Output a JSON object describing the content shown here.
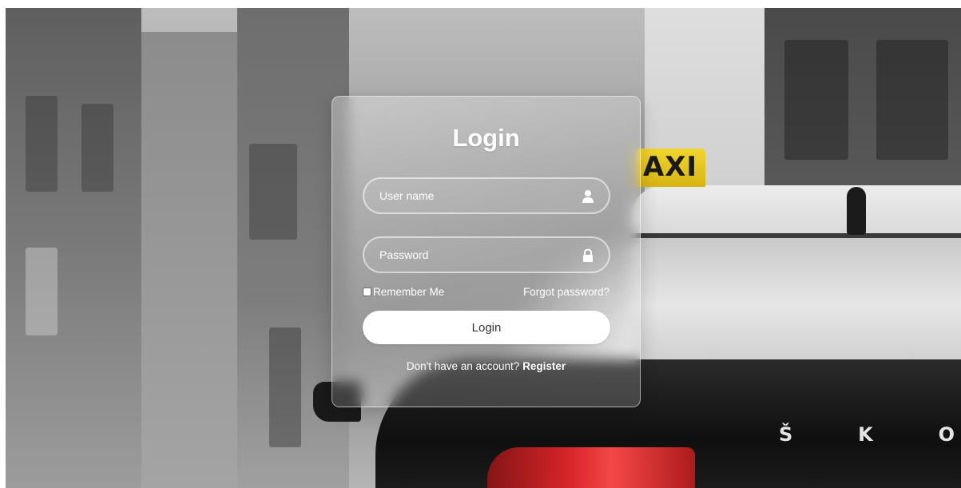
{
  "background": {
    "taxi_sign_text": "AXI",
    "car_badge_letters": [
      "Š",
      "K",
      "O"
    ]
  },
  "login": {
    "title": "Login",
    "username_placeholder": "User name",
    "username_icon": "user-icon",
    "password_placeholder": "Password",
    "password_icon": "lock-icon",
    "remember_label": "Remember Me",
    "remember_checked": false,
    "forgot_label": "Forgot password?",
    "submit_label": "Login",
    "register_prompt": "Don't have an account?",
    "register_link": "Register"
  },
  "colors": {
    "card_text": "#ffffff",
    "button_bg": "#ffffff",
    "button_text": "#333333",
    "taxi_yellow": "#f1d52d",
    "tail_light": "#e3262b"
  }
}
